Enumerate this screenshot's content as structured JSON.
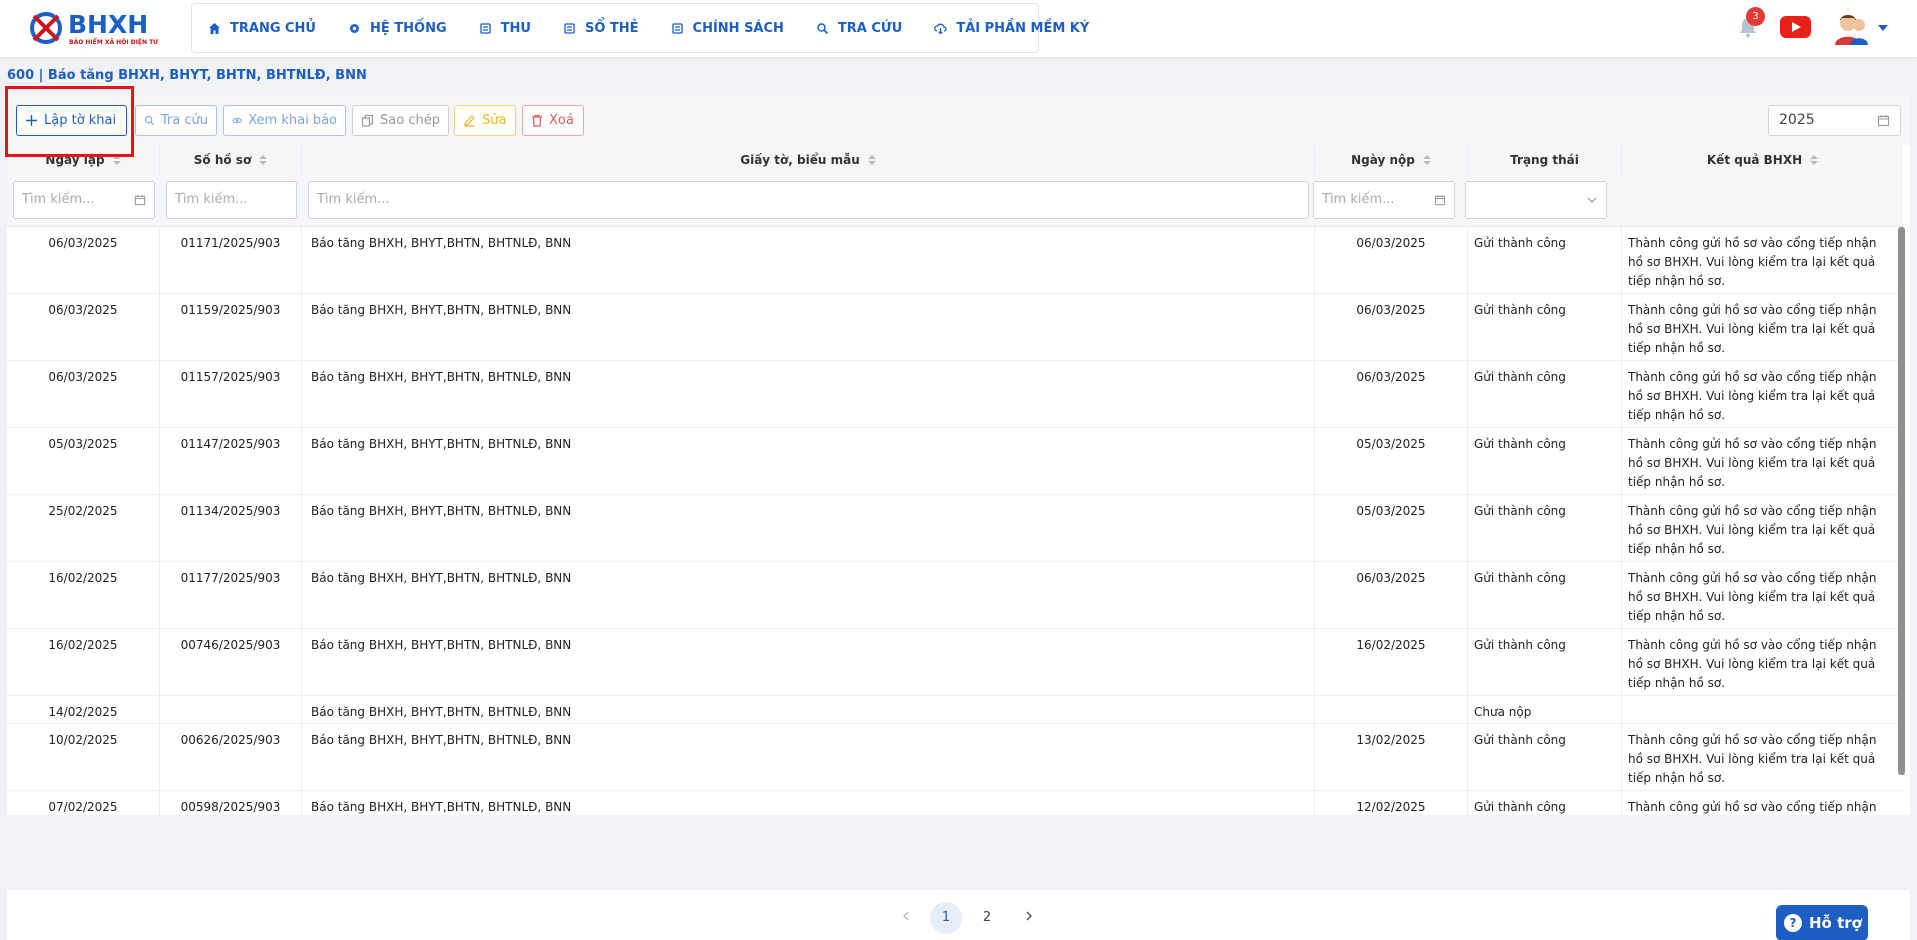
{
  "app": {
    "logo_text": "BHXH",
    "logo_sub": "BẢO HIỂM XÃ HỘI ĐIỆN TỬ",
    "brand_color": "#1d5ec2"
  },
  "nav": [
    {
      "label": "TRANG CHỦ",
      "icon": "home-icon"
    },
    {
      "label": "HỆ THỐNG",
      "icon": "gear-icon"
    },
    {
      "label": "THU",
      "icon": "document-icon"
    },
    {
      "label": "SỔ THẺ",
      "icon": "document-icon"
    },
    {
      "label": "CHÍNH SÁCH",
      "icon": "document-icon"
    },
    {
      "label": "TRA CỨU",
      "icon": "search-icon"
    },
    {
      "label": "TẢI PHẦN MỀM KÝ",
      "icon": "cloud-download-icon"
    }
  ],
  "header": {
    "notification_count": "3"
  },
  "page_title": "600 | Báo tăng BHXH, BHYT, BHTN, BHTNLĐ, BNN",
  "toolbar": {
    "create": "Lập tờ khai",
    "search": "Tra cứu",
    "view": "Xem khai báo",
    "copy": "Sao chép",
    "edit": "Sửa",
    "delete": "Xoá",
    "year": "2025"
  },
  "table": {
    "headers": {
      "date": "Ngày lập",
      "file_no": "Số hồ sơ",
      "doc": "Giấy tờ, biểu mẫu",
      "submit_date": "Ngày nộp",
      "status": "Trạng thái",
      "result": "Kết quả BHXH"
    },
    "filter_placeholder": "Tìm kiếm...",
    "rows": [
      {
        "date": "06/03/2025",
        "file_no": "01171/2025/903",
        "doc": "Báo tăng BHXH, BHYT,BHTN, BHTNLĐ, BNN",
        "submit_date": "06/03/2025",
        "status": "Gửi thành công",
        "result": "Thành công gửi hồ sơ vào cổng tiếp nhận hồ sơ BHXH. Vui lòng kiểm tra lại kết quả tiếp nhận hồ sơ."
      },
      {
        "date": "06/03/2025",
        "file_no": "01159/2025/903",
        "doc": "Báo tăng BHXH, BHYT,BHTN, BHTNLĐ, BNN",
        "submit_date": "06/03/2025",
        "status": "Gửi thành công",
        "result": "Thành công gửi hồ sơ vào cổng tiếp nhận hồ sơ BHXH. Vui lòng kiểm tra lại kết quả tiếp nhận hồ sơ."
      },
      {
        "date": "06/03/2025",
        "file_no": "01157/2025/903",
        "doc": "Báo tăng BHXH, BHYT,BHTN, BHTNLĐ, BNN",
        "submit_date": "06/03/2025",
        "status": "Gửi thành công",
        "result": "Thành công gửi hồ sơ vào cổng tiếp nhận hồ sơ BHXH. Vui lòng kiểm tra lại kết quả tiếp nhận hồ sơ."
      },
      {
        "date": "05/03/2025",
        "file_no": "01147/2025/903",
        "doc": "Báo tăng BHXH, BHYT,BHTN, BHTNLĐ, BNN",
        "submit_date": "05/03/2025",
        "status": "Gửi thành công",
        "result": "Thành công gửi hồ sơ vào cổng tiếp nhận hồ sơ BHXH. Vui lòng kiểm tra lại kết quả tiếp nhận hồ sơ."
      },
      {
        "date": "25/02/2025",
        "file_no": "01134/2025/903",
        "doc": "Báo tăng BHXH, BHYT,BHTN, BHTNLĐ, BNN",
        "submit_date": "05/03/2025",
        "status": "Gửi thành công",
        "result": "Thành công gửi hồ sơ vào cổng tiếp nhận hồ sơ BHXH. Vui lòng kiểm tra lại kết quả tiếp nhận hồ sơ."
      },
      {
        "date": "16/02/2025",
        "file_no": "01177/2025/903",
        "doc": "Báo tăng BHXH, BHYT,BHTN, BHTNLĐ, BNN",
        "submit_date": "06/03/2025",
        "status": "Gửi thành công",
        "result": "Thành công gửi hồ sơ vào cổng tiếp nhận hồ sơ BHXH. Vui lòng kiểm tra lại kết quả tiếp nhận hồ sơ."
      },
      {
        "date": "16/02/2025",
        "file_no": "00746/2025/903",
        "doc": "Báo tăng BHXH, BHYT,BHTN, BHTNLĐ, BNN",
        "submit_date": "16/02/2025",
        "status": "Gửi thành công",
        "result": "Thành công gửi hồ sơ vào cổng tiếp nhận hồ sơ BHXH. Vui lòng kiểm tra lại kết quả tiếp nhận hồ sơ."
      },
      {
        "date": "14/02/2025",
        "file_no": "",
        "doc": "Báo tăng BHXH, BHYT,BHTN, BHTNLĐ, BNN",
        "submit_date": "",
        "status": "Chưa nộp",
        "result": ""
      },
      {
        "date": "10/02/2025",
        "file_no": "00626/2025/903",
        "doc": "Báo tăng BHXH, BHYT,BHTN, BHTNLĐ, BNN",
        "submit_date": "13/02/2025",
        "status": "Gửi thành công",
        "result": "Thành công gửi hồ sơ vào cổng tiếp nhận hồ sơ BHXH. Vui lòng kiểm tra lại kết quả tiếp nhận hồ sơ."
      },
      {
        "date": "07/02/2025",
        "file_no": "00598/2025/903",
        "doc": "Báo tăng BHXH, BHYT,BHTN, BHTNLĐ, BNN",
        "submit_date": "12/02/2025",
        "status": "Gửi thành công",
        "result": "Thành công gửi hồ sơ vào cổng tiếp nhận hồ sơ BHXH. Vui lòng kiểm tra lại kết quả tiếp nhận hồ sơ."
      }
    ]
  },
  "pagination": {
    "pages": [
      "1",
      "2"
    ],
    "current": "1"
  },
  "help": {
    "label": "Hỗ trợ",
    "q": "?"
  }
}
